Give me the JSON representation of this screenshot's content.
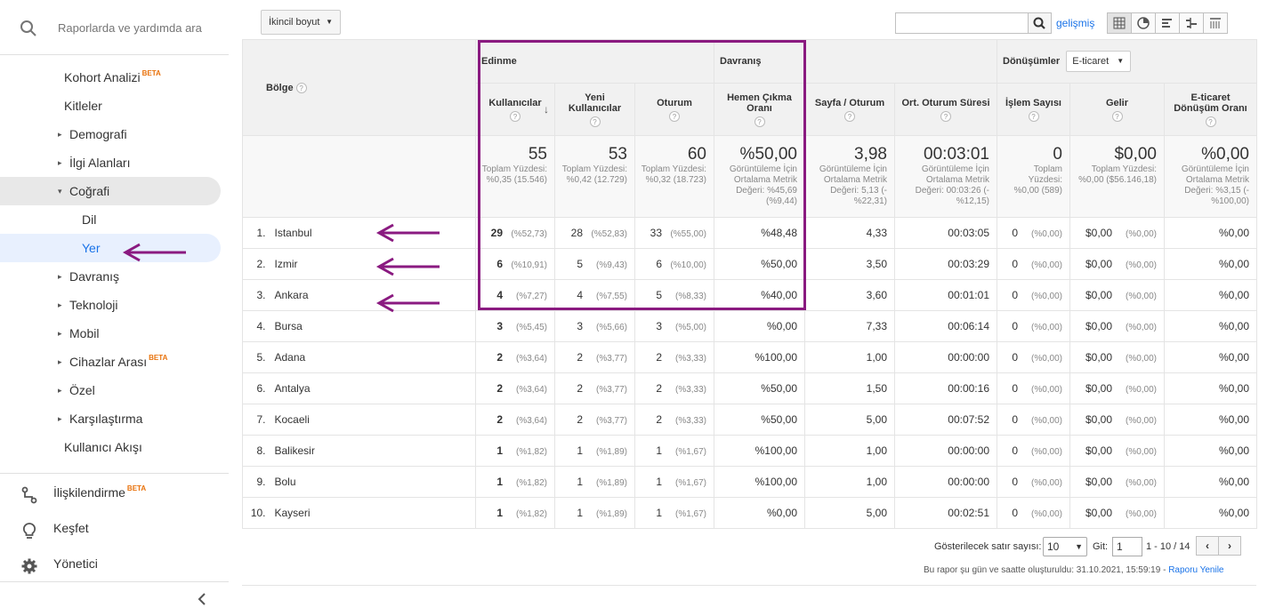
{
  "sidebar": {
    "search_placeholder": "Raporlarda ve yardımda ara",
    "nav": [
      {
        "label": "Kohort Analizi",
        "beta": "BETA",
        "indent": "top",
        "triangle": ""
      },
      {
        "label": "Kitleler",
        "beta": "",
        "indent": "top",
        "triangle": ""
      },
      {
        "label": "Demografi",
        "beta": "",
        "indent": "group",
        "triangle": "▸"
      },
      {
        "label": "İlgi Alanları",
        "beta": "",
        "indent": "group",
        "triangle": "▸"
      },
      {
        "label": "Coğrafi",
        "beta": "",
        "indent": "group",
        "triangle": "▾"
      },
      {
        "label": "Dil",
        "beta": "",
        "indent": "child",
        "triangle": ""
      },
      {
        "label": "Yer",
        "beta": "",
        "indent": "child",
        "triangle": ""
      },
      {
        "label": "Davranış",
        "beta": "",
        "indent": "group",
        "triangle": "▸"
      },
      {
        "label": "Teknoloji",
        "beta": "",
        "indent": "group",
        "triangle": "▸"
      },
      {
        "label": "Mobil",
        "beta": "",
        "indent": "group",
        "triangle": "▸"
      },
      {
        "label": "Cihazlar Arası",
        "beta": "BETA",
        "indent": "group",
        "triangle": "▸"
      },
      {
        "label": "Özel",
        "beta": "",
        "indent": "group",
        "triangle": "▸"
      },
      {
        "label": "Karşılaştırma",
        "beta": "",
        "indent": "group",
        "triangle": "▸"
      },
      {
        "label": "Kullanıcı Akışı",
        "beta": "",
        "indent": "top",
        "triangle": ""
      }
    ],
    "selected_group": "Coğrafi",
    "active_item": "Yer",
    "bottom": [
      {
        "label": "İlişkilendirme",
        "beta": "BETA",
        "icon": "attribution-icon"
      },
      {
        "label": "Keşfet",
        "beta": "",
        "icon": "lightbulb-icon"
      },
      {
        "label": "Yönetici",
        "beta": "",
        "icon": "gear-icon"
      }
    ]
  },
  "toolbar": {
    "secondary_dimension": "İkincil boyut",
    "advanced": "gelişmiş",
    "search_value": ""
  },
  "table": {
    "group_headers": {
      "acquisition": "Edinme",
      "behavior": "Davranış",
      "conversions": "Dönüşümler",
      "conversion_select": "E-ticaret"
    },
    "dimension": "Bölge",
    "columns": [
      "Kullanıcılar",
      "Yeni Kullanıcılar",
      "Oturum",
      "Hemen Çıkma Oranı",
      "Sayfa / Oturum",
      "Ort. Oturum Süresi",
      "İşlem Sayısı",
      "Gelir",
      "E-ticaret Dönüşüm Oranı"
    ],
    "totals": [
      {
        "big": "55",
        "sub": "Toplam Yüzdesi: %0,35 (15.546)"
      },
      {
        "big": "53",
        "sub": "Toplam Yüzdesi: %0,42 (12.729)"
      },
      {
        "big": "60",
        "sub": "Toplam Yüzdesi: %0,32 (18.723)"
      },
      {
        "big": "%50,00",
        "sub": "Görüntüleme İçin Ortalama Metrik Değeri: %45,69 (%9,44)"
      },
      {
        "big": "3,98",
        "sub": "Görüntüleme İçin Ortalama Metrik Değeri: 5,13 (-%22,31)"
      },
      {
        "big": "00:03:01",
        "sub": "Görüntüleme İçin Ortalama Metrik Değeri: 00:03:26 (-%12,15)"
      },
      {
        "big": "0",
        "sub": "Toplam Yüzdesi: %0,00 (589)"
      },
      {
        "big": "$0,00",
        "sub": "Toplam Yüzdesi: %0,00 ($56.146,18)"
      },
      {
        "big": "%0,00",
        "sub": "Görüntüleme İçin Ortalama Metrik Değeri: %3,15 (-%100,00)"
      }
    ],
    "rows": [
      {
        "idx": "1.",
        "name": "Istanbul",
        "users": "29",
        "users_pct": "(%52,73)",
        "new_users": "28",
        "new_users_pct": "(%52,83)",
        "sessions": "33",
        "sessions_pct": "(%55,00)",
        "bounce": "%48,48",
        "pages": "4,33",
        "duration": "00:03:05",
        "tx": "0",
        "tx_pct": "(%0,00)",
        "revenue": "$0,00",
        "revenue_pct": "(%0,00)",
        "conv": "%0,00"
      },
      {
        "idx": "2.",
        "name": "Izmir",
        "users": "6",
        "users_pct": "(%10,91)",
        "new_users": "5",
        "new_users_pct": "(%9,43)",
        "sessions": "6",
        "sessions_pct": "(%10,00)",
        "bounce": "%50,00",
        "pages": "3,50",
        "duration": "00:03:29",
        "tx": "0",
        "tx_pct": "(%0,00)",
        "revenue": "$0,00",
        "revenue_pct": "(%0,00)",
        "conv": "%0,00"
      },
      {
        "idx": "3.",
        "name": "Ankara",
        "users": "4",
        "users_pct": "(%7,27)",
        "new_users": "4",
        "new_users_pct": "(%7,55)",
        "sessions": "5",
        "sessions_pct": "(%8,33)",
        "bounce": "%40,00",
        "pages": "3,60",
        "duration": "00:01:01",
        "tx": "0",
        "tx_pct": "(%0,00)",
        "revenue": "$0,00",
        "revenue_pct": "(%0,00)",
        "conv": "%0,00"
      },
      {
        "idx": "4.",
        "name": "Bursa",
        "users": "3",
        "users_pct": "(%5,45)",
        "new_users": "3",
        "new_users_pct": "(%5,66)",
        "sessions": "3",
        "sessions_pct": "(%5,00)",
        "bounce": "%0,00",
        "pages": "7,33",
        "duration": "00:06:14",
        "tx": "0",
        "tx_pct": "(%0,00)",
        "revenue": "$0,00",
        "revenue_pct": "(%0,00)",
        "conv": "%0,00"
      },
      {
        "idx": "5.",
        "name": "Adana",
        "users": "2",
        "users_pct": "(%3,64)",
        "new_users": "2",
        "new_users_pct": "(%3,77)",
        "sessions": "2",
        "sessions_pct": "(%3,33)",
        "bounce": "%100,00",
        "pages": "1,00",
        "duration": "00:00:00",
        "tx": "0",
        "tx_pct": "(%0,00)",
        "revenue": "$0,00",
        "revenue_pct": "(%0,00)",
        "conv": "%0,00"
      },
      {
        "idx": "6.",
        "name": "Antalya",
        "users": "2",
        "users_pct": "(%3,64)",
        "new_users": "2",
        "new_users_pct": "(%3,77)",
        "sessions": "2",
        "sessions_pct": "(%3,33)",
        "bounce": "%50,00",
        "pages": "1,50",
        "duration": "00:00:16",
        "tx": "0",
        "tx_pct": "(%0,00)",
        "revenue": "$0,00",
        "revenue_pct": "(%0,00)",
        "conv": "%0,00"
      },
      {
        "idx": "7.",
        "name": "Kocaeli",
        "users": "2",
        "users_pct": "(%3,64)",
        "new_users": "2",
        "new_users_pct": "(%3,77)",
        "sessions": "2",
        "sessions_pct": "(%3,33)",
        "bounce": "%50,00",
        "pages": "5,00",
        "duration": "00:07:52",
        "tx": "0",
        "tx_pct": "(%0,00)",
        "revenue": "$0,00",
        "revenue_pct": "(%0,00)",
        "conv": "%0,00"
      },
      {
        "idx": "8.",
        "name": "Balikesir",
        "users": "1",
        "users_pct": "(%1,82)",
        "new_users": "1",
        "new_users_pct": "(%1,89)",
        "sessions": "1",
        "sessions_pct": "(%1,67)",
        "bounce": "%100,00",
        "pages": "1,00",
        "duration": "00:00:00",
        "tx": "0",
        "tx_pct": "(%0,00)",
        "revenue": "$0,00",
        "revenue_pct": "(%0,00)",
        "conv": "%0,00"
      },
      {
        "idx": "9.",
        "name": "Bolu",
        "users": "1",
        "users_pct": "(%1,82)",
        "new_users": "1",
        "new_users_pct": "(%1,89)",
        "sessions": "1",
        "sessions_pct": "(%1,67)",
        "bounce": "%100,00",
        "pages": "1,00",
        "duration": "00:00:00",
        "tx": "0",
        "tx_pct": "(%0,00)",
        "revenue": "$0,00",
        "revenue_pct": "(%0,00)",
        "conv": "%0,00"
      },
      {
        "idx": "10.",
        "name": "Kayseri",
        "users": "1",
        "users_pct": "(%1,82)",
        "new_users": "1",
        "new_users_pct": "(%1,89)",
        "sessions": "1",
        "sessions_pct": "(%1,67)",
        "bounce": "%0,00",
        "pages": "5,00",
        "duration": "00:02:51",
        "tx": "0",
        "tx_pct": "(%0,00)",
        "revenue": "$0,00",
        "revenue_pct": "(%0,00)",
        "conv": "%0,00"
      }
    ]
  },
  "pager": {
    "rows_label": "Gösterilecek satır sayısı:",
    "rows_value": "10",
    "goto_label": "Git:",
    "goto_value": "1",
    "range": "1 - 10 / 14",
    "prev": "‹",
    "next": "›"
  },
  "footer": {
    "note": "Bu rapor şu gün ve saatte oluşturuldu: 31.10.2021, 15:59:19 - ",
    "refresh_link": "Raporu Yenile"
  },
  "annotation": {
    "color": "#8a1a80"
  }
}
